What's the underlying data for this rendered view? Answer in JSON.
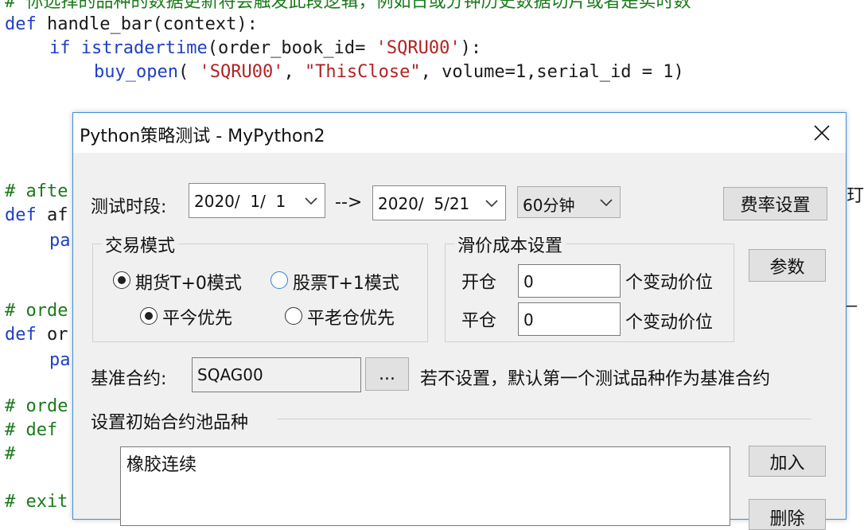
{
  "editor": {
    "line0": "# 你选择的品种的数据更新将会触发此段逻辑，例如日或分钟历史数据切片或者是实时数",
    "line1_kw": "def",
    "line1_rest": " handle_bar(context):",
    "line2_kw": "if",
    "line2_fn": "istradertime",
    "line2_a": "(order_book_id= ",
    "line2_str": "'SQRU00'",
    "line2_b": "):",
    "line3_fn": "buy_open",
    "line3_a": "( ",
    "line3_str1": "'SQRU00'",
    "line3_b": ", ",
    "line3_str2": "\"ThisClose\"",
    "line3_c": ", volume=1,serial_id = 1)",
    "line4": "# afte",
    "line5_kw": "def",
    "line5_rest": " af",
    "line6": "pa",
    "line7": "# orde",
    "line8_kw": "def",
    "line8_rest": " or",
    "line9": "pa",
    "line10": "# orde",
    "line11": "# def",
    "line12": "#",
    "line13": "# exit",
    "right1": "玎",
    "right2": "—"
  },
  "dialog": {
    "title": "Python策略测试 - MyPython2",
    "period_label": "测试时段:",
    "start_date": "2020/  1/  1",
    "arrow_text": "-->",
    "end_date": "2020/  5/21",
    "interval": "60分钟",
    "fee_button": "费率设置",
    "params_button": "参数",
    "trade_mode": {
      "title": "交易模式",
      "futures": "期货T+0模式",
      "stocks": "股票T+1模式",
      "close_today": "平今优先",
      "close_old": "平老仓优先"
    },
    "slippage": {
      "title": "滑价成本设置",
      "open_label": "开仓",
      "open_value": "0",
      "close_label": "平仓",
      "close_value": "0",
      "unit": "个变动价位"
    },
    "benchmark_label": "基准合约:",
    "benchmark_value": "SQAG00",
    "browse_button": "...",
    "benchmark_hint": "若不设置，默认第一个测试品种作为基准合约",
    "pool_title": "设置初始合约池品种",
    "pool_items": [
      "橡胶连续"
    ],
    "add_button": "加入",
    "delete_button": "删除"
  }
}
